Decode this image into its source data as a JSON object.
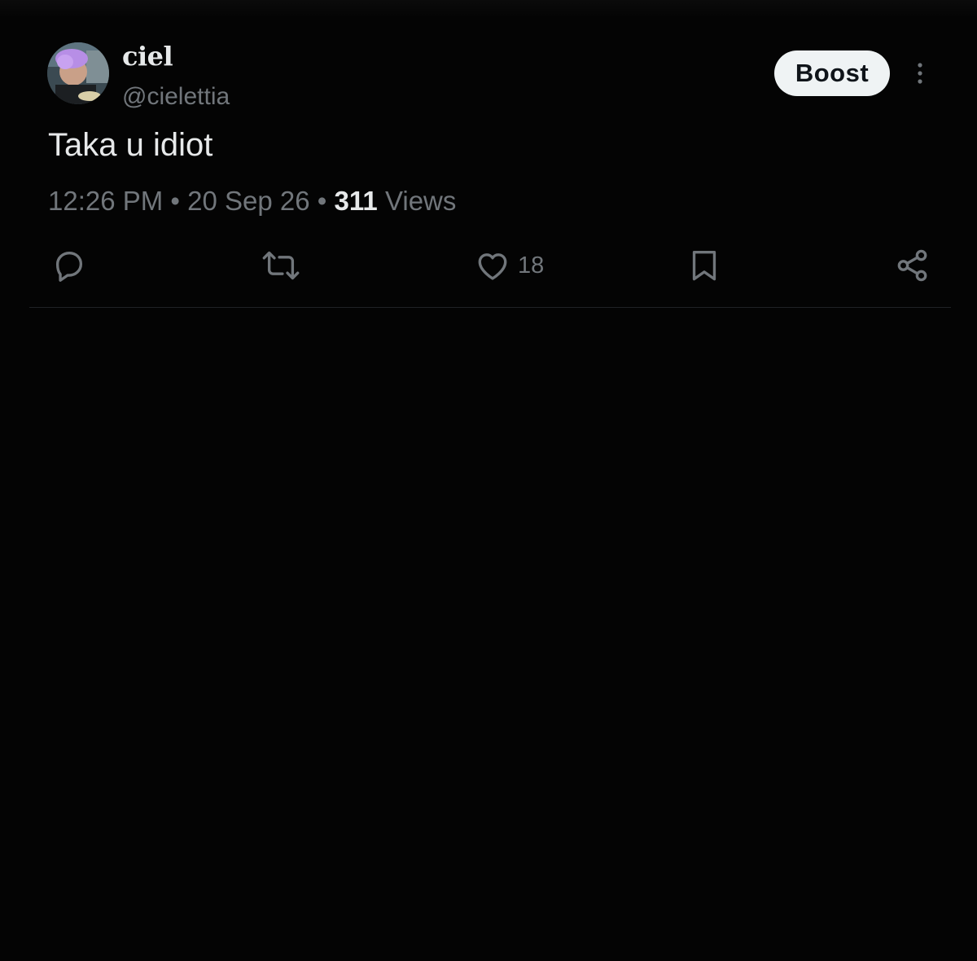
{
  "post": {
    "author": {
      "display_name": "ciel",
      "handle": "@cielettia",
      "avatar": "profile-photo"
    },
    "boost_label": "Boost",
    "text": "Taka u idiot",
    "time": "12:26 PM",
    "date": "20 Sep 26",
    "separator": "•",
    "views_count": "311",
    "views_label": "Views",
    "actions": {
      "reply": {
        "icon": "reply-icon"
      },
      "repost": {
        "icon": "repost-icon"
      },
      "like": {
        "icon": "heart-icon",
        "count": "18"
      },
      "bookmark": {
        "icon": "bookmark-icon"
      },
      "share": {
        "icon": "share-icon"
      }
    }
  },
  "colors": {
    "background": "#040404",
    "primary_text": "#e7e9ea",
    "secondary_text": "#71767b",
    "boost_bg": "#eff3f4",
    "divider": "#1f2225"
  }
}
